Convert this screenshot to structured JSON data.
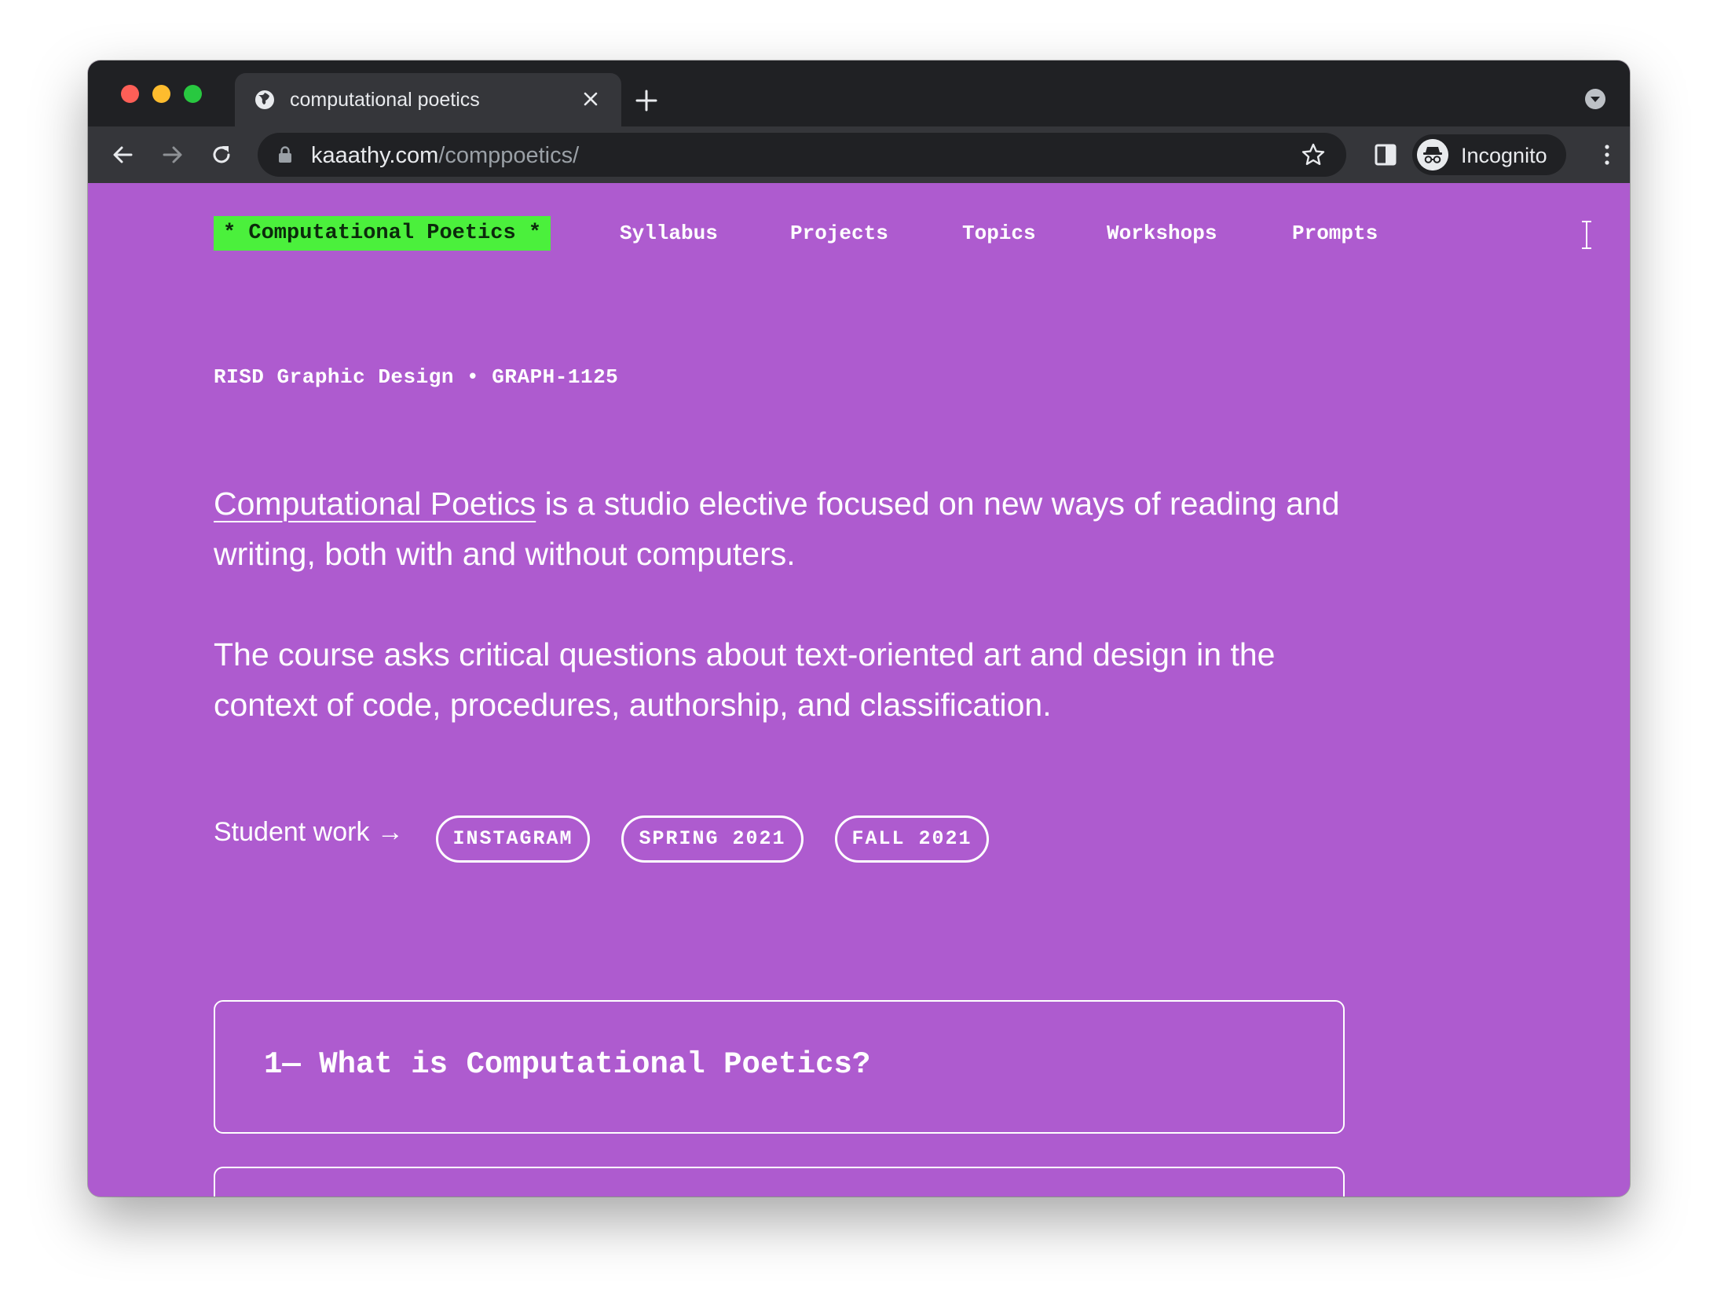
{
  "browser": {
    "tab_title": "computational poetics",
    "url_host": "kaaathy.com",
    "url_path": "/comppoetics/",
    "profile_label": "Incognito"
  },
  "site": {
    "brand": "* Computational Poetics *",
    "nav": [
      "Syllabus",
      "Projects",
      "Topics",
      "Workshops",
      "Prompts"
    ],
    "course_id": "RISD Graphic Design • GRAPH-1125",
    "intro_link": "Computational Poetics",
    "intro_rest": " is a studio elective focused on new ways of reading and writing, both with and without computers.",
    "paragraph2": "The course asks critical questions about text-oriented art and design in the context of code, procedures, authorship, and classification.",
    "student_work_label": "Student work →",
    "student_work_tags": [
      "INSTAGRAM",
      "SPRING 2021",
      "FALL 2021"
    ],
    "sections": [
      {
        "title": "1— What is Computational Poetics?"
      }
    ]
  },
  "colors": {
    "page_bg": "#ae5bcf",
    "brand_bg": "#4bf03c",
    "text": "#ffffff"
  }
}
